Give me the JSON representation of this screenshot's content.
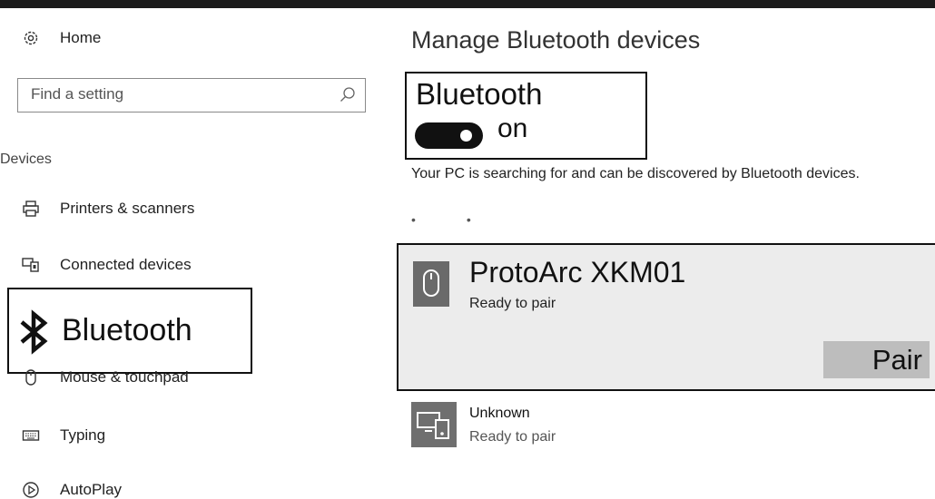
{
  "sidebar": {
    "home_label": "Home",
    "search_placeholder": "Find a setting",
    "section_label": "Devices",
    "items": [
      {
        "label": "Printers & scanners",
        "icon": "printer-icon"
      },
      {
        "label": "Connected devices",
        "icon": "connected-devices-icon"
      },
      {
        "label": "Bluetooth",
        "icon": "bluetooth-icon",
        "selected": true
      },
      {
        "label": "Mouse & touchpad",
        "icon": "mouse-icon"
      },
      {
        "label": "Typing",
        "icon": "keyboard-icon"
      },
      {
        "label": "AutoPlay",
        "icon": "autoplay-icon"
      }
    ]
  },
  "main": {
    "title": "Manage Bluetooth devices",
    "bluetooth_heading": "Bluetooth",
    "toggle_state": "on",
    "toggle_on": true,
    "description": "Your PC is searching for and can be discovered by Bluetooth devices.",
    "devices": [
      {
        "name": "ProtoArc XKM01",
        "status": "Ready to pair",
        "icon": "mouse-device-icon",
        "action": "Pair",
        "selected": true
      },
      {
        "name": "Unknown",
        "status": "Ready to pair",
        "icon": "generic-device-icon"
      }
    ]
  },
  "colors": {
    "frame": "#1c1c1c",
    "selected_card_bg": "#ececec",
    "pair_button_bg": "#bdbdbd",
    "toggle_on": "#111111",
    "device_icon_bg": "#6a6a6a"
  }
}
